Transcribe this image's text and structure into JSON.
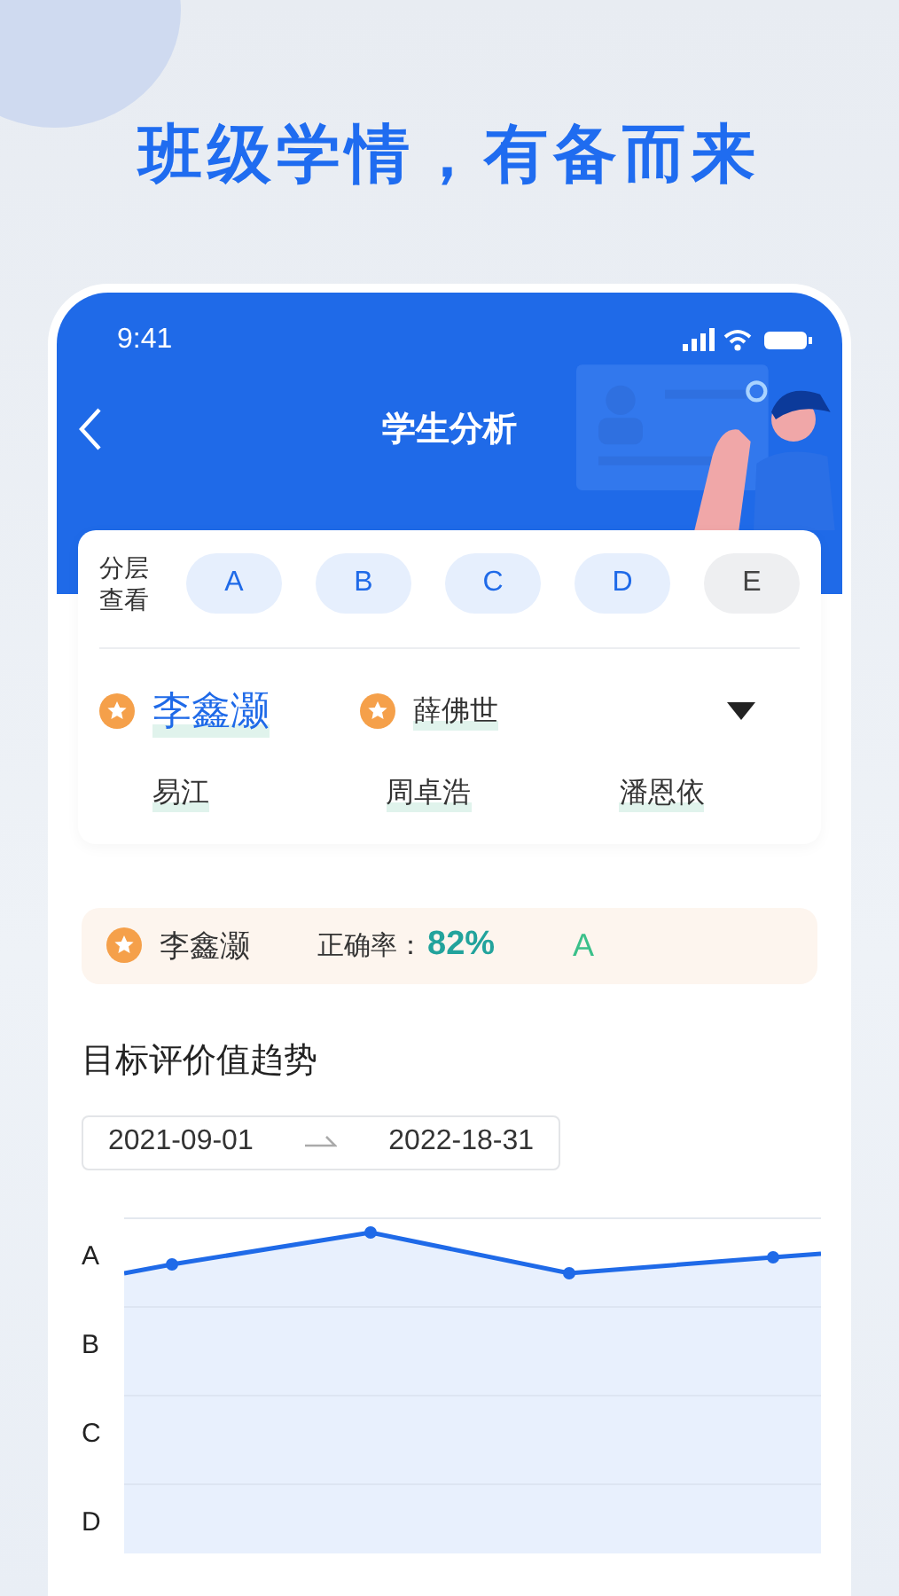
{
  "headline": "班级学情，有备而来",
  "status_bar": {
    "time": "9:41"
  },
  "nav": {
    "title": "学生分析"
  },
  "layer_filter": {
    "label": "分层查看",
    "options": [
      {
        "label": "A",
        "selected": true
      },
      {
        "label": "B",
        "selected": true
      },
      {
        "label": "C",
        "selected": true
      },
      {
        "label": "D",
        "selected": true
      },
      {
        "label": "E",
        "selected": false
      }
    ]
  },
  "students": [
    {
      "name": "李鑫灏",
      "starred": true,
      "selected": true
    },
    {
      "name": "薛佛世",
      "starred": true,
      "selected": false
    },
    {
      "name": "易江",
      "starred": false,
      "selected": false
    },
    {
      "name": "周卓浩",
      "starred": false,
      "selected": false
    },
    {
      "name": "潘恩依",
      "starred": false,
      "selected": false
    }
  ],
  "summary": {
    "name": "李鑫灏",
    "starred": true,
    "accuracy_label": "正确率：",
    "accuracy": "82%",
    "grade": "A"
  },
  "trend": {
    "title": "目标评价值趋势",
    "start_date": "2021-09-01",
    "end_date": "2022-18-31",
    "y_labels": [
      "A",
      "B",
      "C",
      "D"
    ]
  }
}
